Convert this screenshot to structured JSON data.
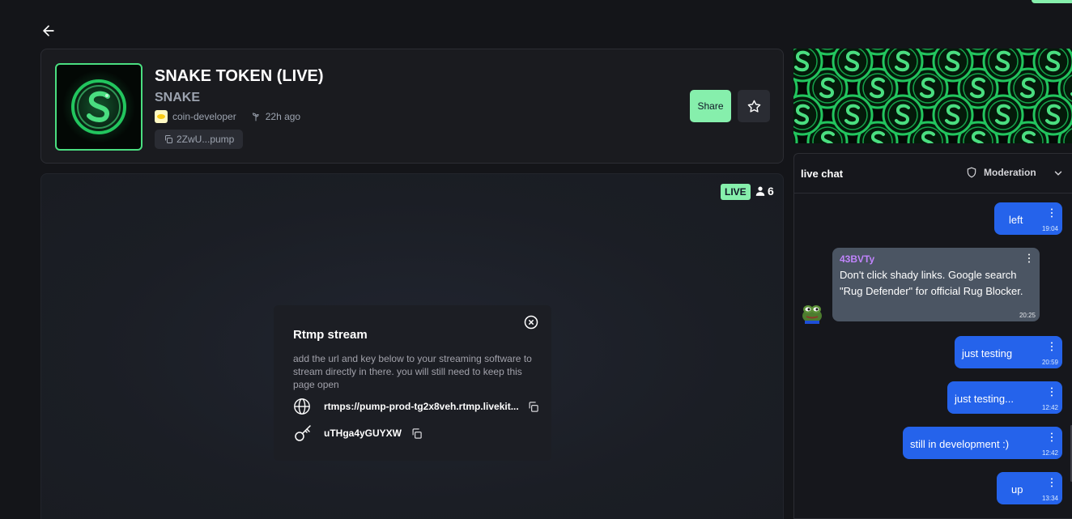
{
  "token": {
    "name": "SNAKE TOKEN (LIVE)",
    "ticker": "SNAKE",
    "creator": "coin-developer",
    "age": "22h ago",
    "contract_address": "2ZwU...pump",
    "share_label": "Share"
  },
  "stream": {
    "live_label": "LIVE",
    "viewers": "6"
  },
  "rtmp": {
    "title": "Rtmp stream",
    "description": "add the url and key below to your streaming software to stream directly in there. you will still need to keep this page open",
    "url": "rtmps://pump-prod-tg2x8veh.rtmp.livekit...",
    "key": "uTHga4yGUYXW"
  },
  "chat": {
    "title": "live chat",
    "moderation_label": "Moderation",
    "messages": [
      {
        "text": "left",
        "time": "19:04",
        "mine": true
      },
      {
        "user": "43BVTy",
        "text": "Don't click shady links. Google search \"Rug Defender\" for official Rug Blocker.",
        "time": "20:25",
        "mine": false
      },
      {
        "text": "just testing",
        "time": "20:59",
        "mine": true
      },
      {
        "text": "just testing...",
        "time": "12:42",
        "mine": true
      },
      {
        "text": "still in development :)",
        "time": "12:42",
        "mine": true
      },
      {
        "text": "up",
        "time": "13:34",
        "mine": true
      }
    ]
  },
  "colors": {
    "accent_green": "#86efac",
    "message_blue": "#2563eb",
    "username_purple": "#c084fc"
  },
  "icons": [
    "arrow-left-icon",
    "sprout-icon",
    "copy-icon",
    "star-icon",
    "user-icon",
    "close-circle-icon",
    "globe-icon",
    "key-icon",
    "shield-icon",
    "chevron-down-icon",
    "kebab-icon"
  ]
}
